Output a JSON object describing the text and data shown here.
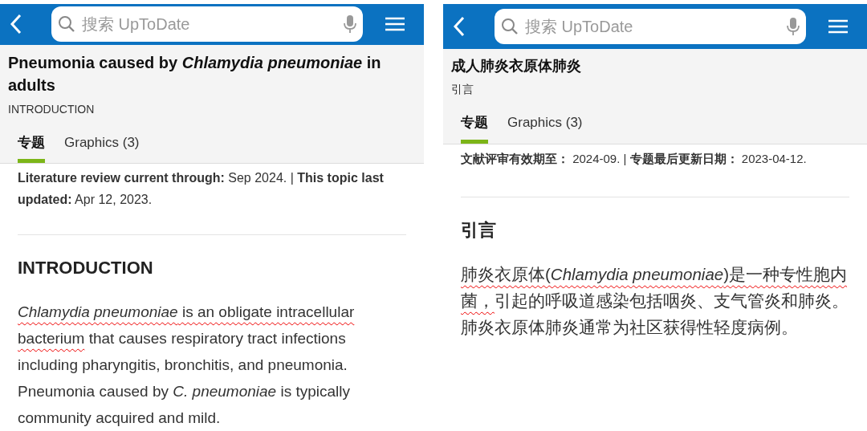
{
  "panels": [
    {
      "search": {
        "placeholder": "搜索 UpToDate"
      },
      "title": "Pneumonia caused by *Chlamydia pneumoniae* in adults",
      "subtitle": "INTRODUCTION",
      "tabs": [
        {
          "label": "专题",
          "selected": true
        },
        {
          "label": "Graphics (3)",
          "selected": false
        }
      ],
      "meta": "**Literature review current through:** Sep 2024. | **This topic last updated:** Apr 12, 2023.",
      "heading": "INTRODUCTION",
      "paragraph": [
        {
          "text": "*Chlamydia pneumoniae* is an obligate intracellular bacterium",
          "underlined": true
        },
        {
          "text": " that causes respiratory tract infections including pharyngitis, bronchitis, and pneumonia. Pneumonia caused by *C. pneumoniae* is typically community acquired and mild.",
          "underlined": false
        }
      ]
    },
    {
      "search": {
        "placeholder": "搜索 UpToDate"
      },
      "title": "成人肺炎衣原体肺炎",
      "subtitle": "引言",
      "tabs": [
        {
          "label": "专题",
          "selected": true
        },
        {
          "label": "Graphics (3)",
          "selected": false
        }
      ],
      "meta": "**文献评审有效期至：** 2024-09. | **专题最后更新日期：** 2023-04-12.",
      "heading": "引言",
      "paragraph": [
        {
          "text": "肺炎衣原体(*Chlamydia pneumoniae*)是一种专性胞内菌，",
          "underlined": true
        },
        {
          "text": "引起的呼吸道感染包括咽炎、支气管炎和肺炎。肺炎衣原体肺炎通常为社区获得性轻度病例。",
          "underlined": false
        }
      ]
    }
  ]
}
